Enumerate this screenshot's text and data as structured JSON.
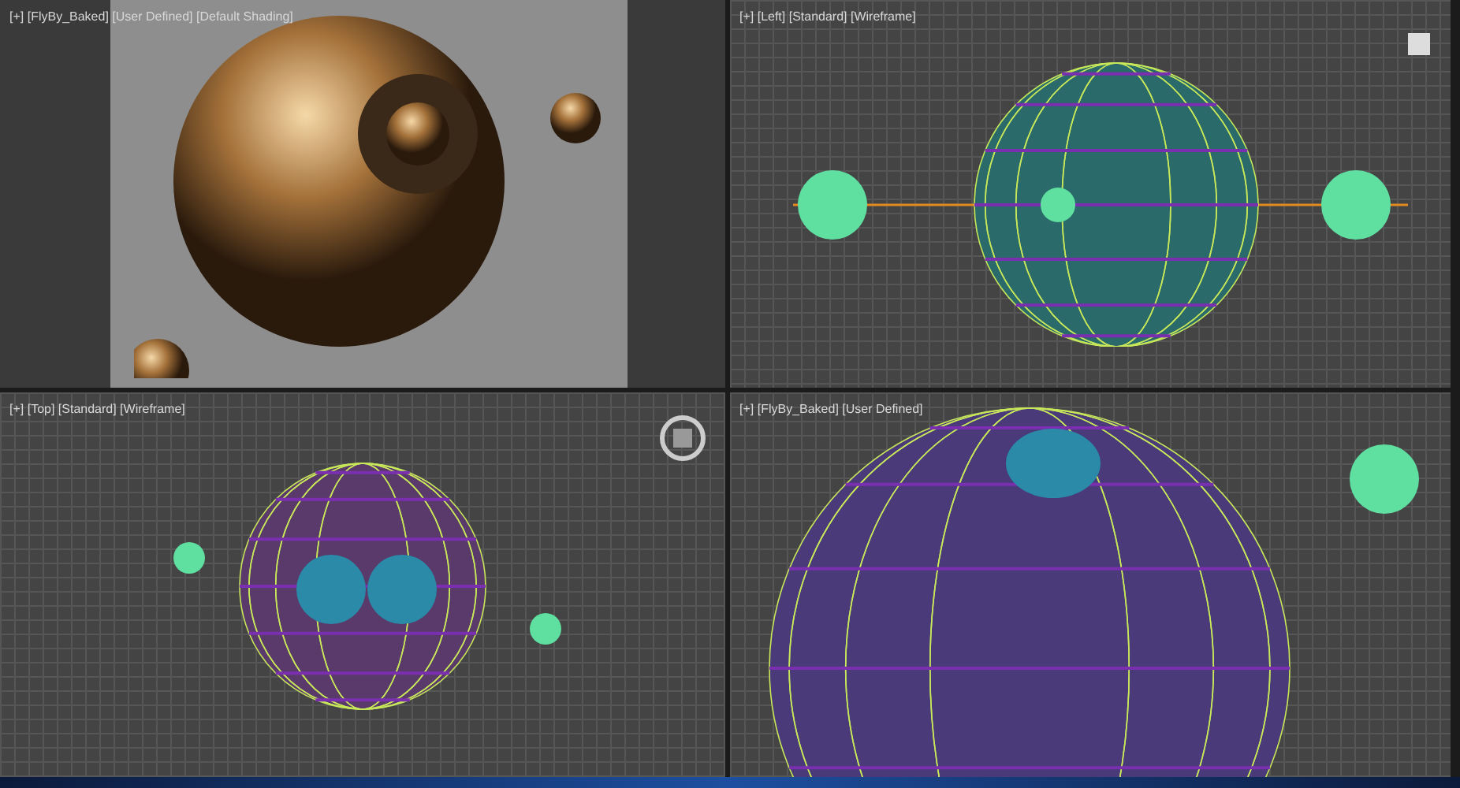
{
  "viewports": [
    {
      "label": "[+] [FlyBy_Baked] [User Defined] [Default Shading]",
      "kind": "render"
    },
    {
      "label": "[+] [Left] [Standard] [Wireframe]",
      "kind": "side"
    },
    {
      "label": "[+] [Top] [Standard] [Wireframe]",
      "kind": "top"
    },
    {
      "label": "[+] [FlyBy_Baked] [User Defined]",
      "kind": "perspective"
    }
  ]
}
